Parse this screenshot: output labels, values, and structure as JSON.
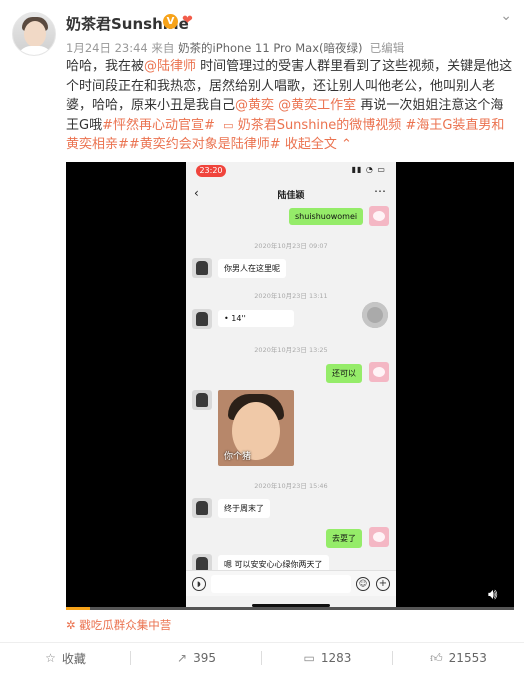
{
  "post": {
    "username": "奶茶君Sunshine",
    "v_badge": "V",
    "heart_badge": "❤",
    "meta": {
      "date": "1月24日 23:44",
      "from_prefix": "来自",
      "device": "奶茶的iPhone 11 Pro Max(暗夜绿)",
      "edited": "已编辑"
    },
    "text": {
      "p1": "哈哈，我在被",
      "mention1": "@陆律师",
      "p2": " 时间管理过的受害人群里看到了这些视频，关键是他这个时间段正在和我热恋，居然给别人唱歌，还让别人叫他老公，他叫别人老婆，哈哈，原来小丑是我自己",
      "mention2": "@黄奕",
      "mention3": "@黄奕工作室",
      "p3": " 再说一次姐姐注意这个海王G哦",
      "tag1": "#怦然再心动官宣#",
      "video_link": "奶茶君Sunshine的微博视频",
      "tag2": "#海王G装直男和黄奕相亲#",
      "tag3": "#黄奕约会对象是陆律师#",
      "collapse": "收起全文"
    },
    "video": {
      "status_time": "23:20",
      "chat_title": "陆佳颖",
      "messages": {
        "m1": "shuishuowomei",
        "t1": "2020年10月23日 09:07",
        "m2": "你男人在这里呢",
        "t2": "2020年10月23日 13:11",
        "m3": "14''",
        "t3": "2020年10月23日 13:25",
        "m4": "还可以",
        "sticker_caption": "你个猪",
        "t4": "2020年10月23日 15:46",
        "m5": "终于周末了",
        "m6": "去耍了",
        "m7": "嗯 可以安安心心绿你两天了"
      }
    },
    "source_tag": "戳吃瓜群众集中营",
    "actions": {
      "favorite": "收藏",
      "repost": "395",
      "comment": "1283",
      "like": "21553"
    }
  }
}
